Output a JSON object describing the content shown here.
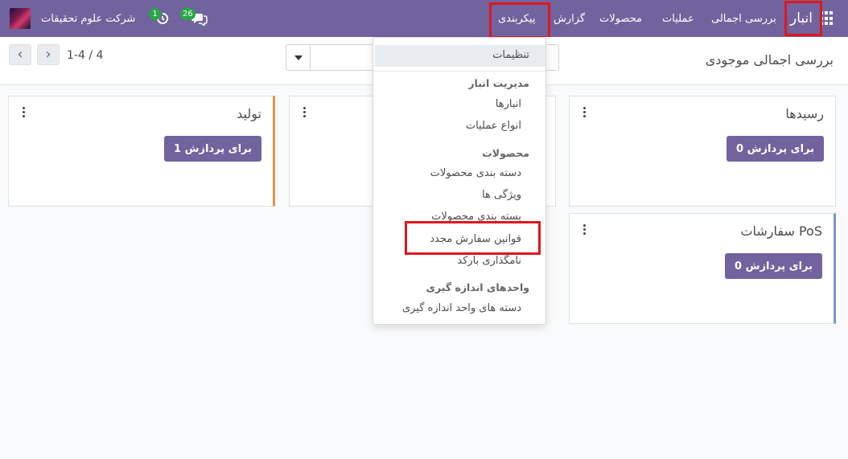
{
  "navbar": {
    "app_name": "انبار",
    "menu": [
      "بررسی اجمالی",
      "عملیات",
      "محصولات",
      "گزارش",
      "پیکربندی"
    ],
    "company": "شرکت علوم تحقیقات",
    "messages_count": "26",
    "activities_count": "1"
  },
  "controlbar": {
    "title": "بررسی اجمالی موجودی",
    "pager": "1-4 / 4"
  },
  "cards": [
    {
      "title": "رسیدها",
      "button": "0 برای پردازش"
    },
    {
      "title": "سفارشات PoS",
      "button": "0 برای پردازش"
    },
    {
      "title": "تولید",
      "button": "1 برای پردازش"
    }
  ],
  "dropdown": {
    "settings": "تنظیمات",
    "sections": [
      {
        "header": "مدیریت انبار",
        "items": [
          "انبارها",
          "انواع عملیات"
        ]
      },
      {
        "header": "محصولات",
        "items": [
          "دسته بندی محصولات",
          "ویژگی ها",
          "بسته بندی محصولات",
          "قوانین سفارش مجدد",
          "نامگذاری بارکد"
        ]
      },
      {
        "header": "واحدهای اندازه گیری",
        "items": [
          "دسته های واحد اندازه گیری"
        ]
      }
    ]
  },
  "colors": {
    "navbar": "#71639e",
    "highlight": "#e0161d",
    "card_accent_orange": "#e8954c",
    "card_accent_blue": "#7895c9"
  }
}
